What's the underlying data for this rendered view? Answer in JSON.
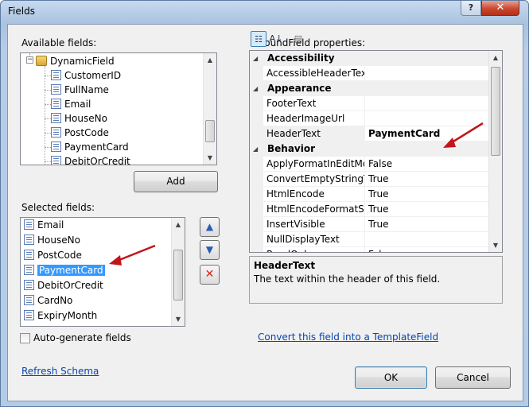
{
  "window": {
    "title": "Fields",
    "help_glyph": "?",
    "close_glyph": "✕"
  },
  "available": {
    "label": "Available fields:",
    "root": "DynamicField",
    "items": [
      "CustomerID",
      "FullName",
      "Email",
      "HouseNo",
      "PostCode",
      "PaymentCard",
      "DebitOrCredit"
    ],
    "add_label": "Add"
  },
  "selected": {
    "label": "Selected fields:",
    "items": [
      "Email",
      "HouseNo",
      "PostCode",
      "PaymentCard",
      "DebitOrCredit",
      "CardNo",
      "ExpiryMonth"
    ],
    "selected_item": "PaymentCard",
    "move_up_glyph": "▲",
    "move_down_glyph": "▼",
    "delete_glyph": "✕",
    "autogen_label": "Auto-generate fields",
    "autogen_checked": false
  },
  "refresh_link": "Refresh Schema",
  "properties": {
    "label": "BoundField properties:",
    "categories": [
      {
        "name": "Accessibility",
        "rows": [
          {
            "name": "AccessibleHeaderText",
            "value": ""
          }
        ]
      },
      {
        "name": "Appearance",
        "rows": [
          {
            "name": "FooterText",
            "value": ""
          },
          {
            "name": "HeaderImageUrl",
            "value": ""
          },
          {
            "name": "HeaderText",
            "value": "PaymentCard"
          }
        ]
      },
      {
        "name": "Behavior",
        "rows": [
          {
            "name": "ApplyFormatInEditMode",
            "value": "False"
          },
          {
            "name": "ConvertEmptyStringToNull",
            "value": "True"
          },
          {
            "name": "HtmlEncode",
            "value": "True"
          },
          {
            "name": "HtmlEncodeFormatString",
            "value": "True"
          },
          {
            "name": "InsertVisible",
            "value": "True"
          },
          {
            "name": "NullDisplayText",
            "value": ""
          },
          {
            "name": "ReadOnly",
            "value": "False"
          }
        ]
      }
    ],
    "selected_property": "HeaderText",
    "description_title": "HeaderText",
    "description_text": "The text within the header of this field."
  },
  "convert_link": "Convert this field into a TemplateField",
  "buttons": {
    "ok": "OK",
    "cancel": "Cancel"
  },
  "colors": {
    "selection": "#3399ff",
    "link": "#0645ad",
    "annotation_arrow": "#c0161b"
  }
}
